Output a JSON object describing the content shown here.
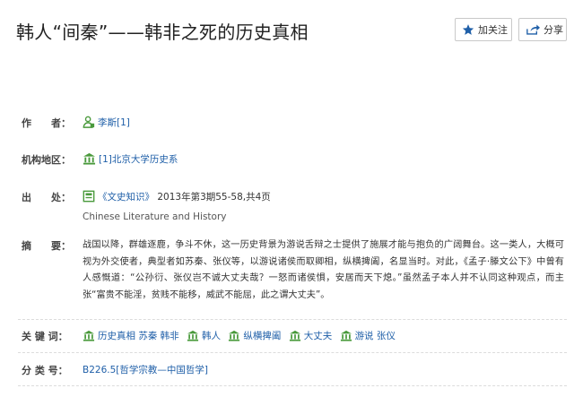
{
  "article": {
    "title": "韩人“间秦”——韩非之死的历史真相"
  },
  "actions": {
    "follow_label": "加关注",
    "share_label": "分享"
  },
  "author": {
    "label": "作　　者：",
    "value": "李斯[1]"
  },
  "institution": {
    "label": "机构地区：",
    "value": "[1]北京大学历史系"
  },
  "source": {
    "label": "出　　处：",
    "journal": "《文史知识》",
    "issue": "2013年第3期55-58,共4页",
    "english": "Chinese Literature and History"
  },
  "abstract": {
    "label": "摘　　要：",
    "text": "战国以降，群雄逐鹿，争斗不休，这一历史背景为游说舌辩之士提供了施展才能与抱负的广阔舞台。这一类人，大概可视为外交使者，典型者如苏秦、张仪等，以游说诸侯而取卿相，纵横捭阖，名显当时。对此，《孟子·滕文公下》中曾有人感慨道：“公孙衍、张仪岂不诚大丈夫哉？一怒而诸侯惧，安居而天下熄。”虽然孟子本人并不认同这种观点，而主张“富贵不能淫，贫贱不能移，威武不能屈，此之谓大丈夫”。"
  },
  "keywords": {
    "label": "关 键 词：",
    "items": [
      "历史真相 苏秦 韩非",
      "韩人",
      "纵横捭阖",
      "大丈夫",
      "游说 张仪"
    ]
  },
  "classification": {
    "label": "分 类 号：",
    "value": "B226.5[哲学宗教—中国哲学]"
  },
  "icons": {
    "follow": "star-icon",
    "share": "share-icon",
    "author": "person-icon",
    "institution": "building-icon",
    "source": "journal-icon",
    "keyword": "keyword-house-icon"
  },
  "colors": {
    "link": "#1f5fa8",
    "icon_green": "#4a9a3c",
    "star_blue": "#1f5fa8"
  }
}
